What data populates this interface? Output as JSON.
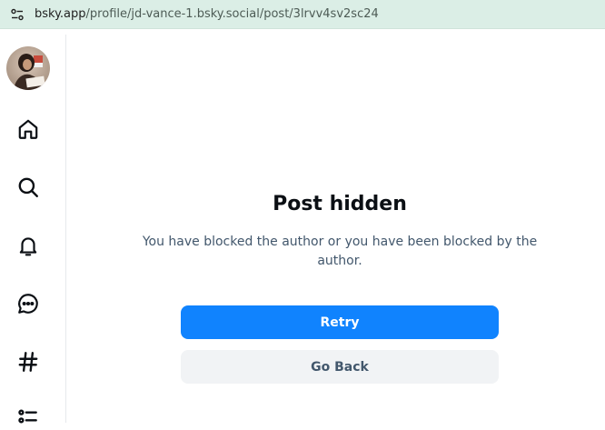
{
  "browser": {
    "url_host": "bsky.app",
    "url_path": "/profile/jd-vance-1.bsky.social/post/3lrvv4sv2sc24"
  },
  "sidebar": {
    "items": [
      {
        "icon": "home-icon"
      },
      {
        "icon": "search-icon"
      },
      {
        "icon": "bell-icon"
      },
      {
        "icon": "chat-icon"
      },
      {
        "icon": "hashtag-icon"
      },
      {
        "icon": "list-icon"
      }
    ]
  },
  "main": {
    "title": "Post hidden",
    "message": "You have blocked the author or you have been blocked by the author.",
    "retry_label": "Retry",
    "back_label": "Go Back"
  },
  "colors": {
    "accent": "#1083fe",
    "address_bar": "#dbeee6",
    "muted_text": "#42576c"
  }
}
